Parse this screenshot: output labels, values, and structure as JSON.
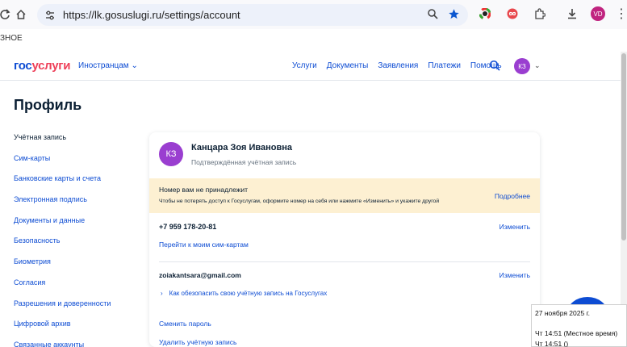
{
  "browser": {
    "url": "https://lk.gosuslugi.ru/settings/account",
    "profile_initials": "VD",
    "bookmark_fragment": "ЗНОЕ"
  },
  "header": {
    "logo_part1": "гос",
    "logo_part2": "услуги",
    "foreigners": "Иностранцам",
    "nav": [
      "Услуги",
      "Документы",
      "Заявления",
      "Платежи",
      "Помощь"
    ],
    "user_initials": "КЗ"
  },
  "page": {
    "title": "Профиль",
    "menu": [
      "Учётная запись",
      "Сим-карты",
      "Банковские карты и счета",
      "Электронная подпись",
      "Документы и данные",
      "Безопасность",
      "Биометрия",
      "Согласия",
      "Разрешения и доверенности",
      "Цифровой архив",
      "Связанные аккаунты"
    ]
  },
  "card": {
    "initials": "КЗ",
    "name": "Канцара Зоя Ивановна",
    "status": "Подтверждённая учётная запись",
    "warning_title": "Номер вам не принадлежит",
    "warning_text": "Чтобы не потерять доступ к Госуслугам, оформите номер на себя или нажмите «Изменить» и укажите другой",
    "warning_link": "Подробнее",
    "phone": "+7 959 178-20-81",
    "change_label": "Изменить",
    "sim_link": "Перейти к моим сим-картам",
    "email": "zoiakantsara@gmail.com",
    "secure_link": "Как обезопасить свою учётную запись на Госуслугах",
    "change_password": "Сменить пароль",
    "delete_account": "Удалить учётную запись"
  },
  "tooltip": {
    "date": "27 ноября 2025 г.",
    "time_local": "Чт 14:51 (Местное время)",
    "time_other": "Чт 14:51 ()"
  },
  "colors": {
    "accent": "#0d4cd3",
    "logo_red": "#ee3f58",
    "avatar": "#9a3ed0",
    "warning_bg": "#fdf0d2"
  }
}
